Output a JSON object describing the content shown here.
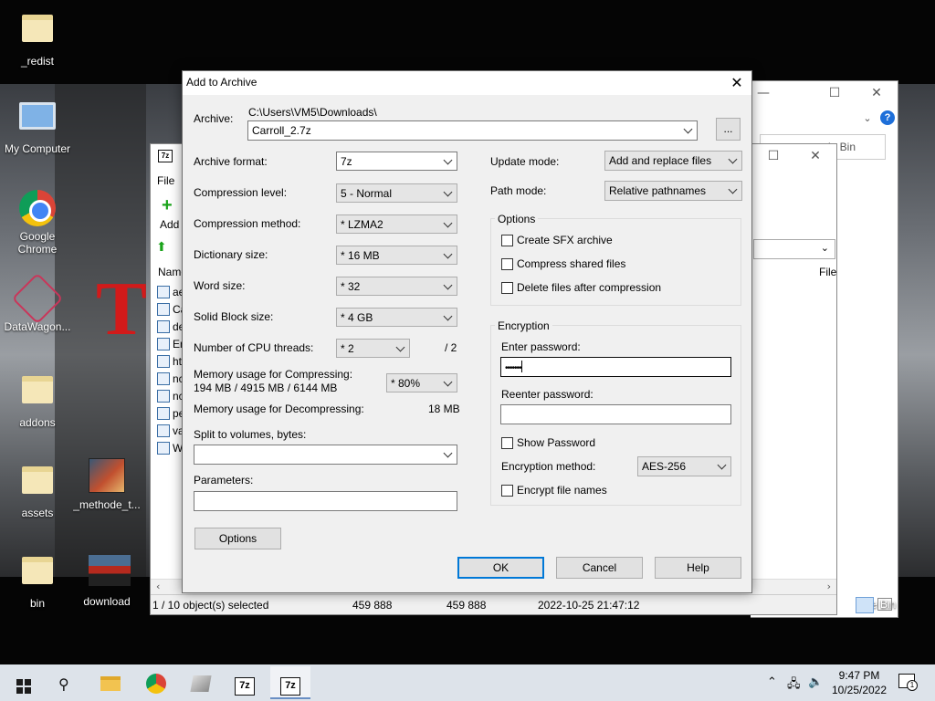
{
  "desktop": {
    "icons": [
      {
        "label": "_redist"
      },
      {
        "label": "My Computer"
      },
      {
        "label": "Google Chrome"
      },
      {
        "label": "DataWagon..."
      },
      {
        "label": "addons"
      },
      {
        "label": "assets"
      },
      {
        "label": "_methode_t..."
      },
      {
        "label": "bin"
      },
      {
        "label": "download"
      }
    ]
  },
  "sevenzip_window": {
    "menu_file": "File",
    "toolbar_add": "Add",
    "column_name": "Name",
    "column_file": "File",
    "files": [
      "ae",
      "Ca",
      "de",
      "En",
      "ht",
      "nc",
      "nc",
      "pe",
      "va",
      "W"
    ],
    "status": {
      "selected": "1 / 10 object(s) selected",
      "size": "459 888",
      "packed": "459 888",
      "modified": "2022-10-25 21:47:12"
    }
  },
  "explorer_window": {
    "search_text": "cycle Bin",
    "recycle_label": "e Bin"
  },
  "dialog": {
    "title": "Add to Archive",
    "archive_label": "Archive:",
    "archive_path": "C:\\Users\\VM5\\Downloads\\",
    "archive_name": "Carroll_2.7z",
    "browse_label": "...",
    "left": {
      "archive_format_label": "Archive format:",
      "archive_format": "7z",
      "compression_level_label": "Compression level:",
      "compression_level": "5 - Normal",
      "compression_method_label": "Compression method:",
      "compression_method": "* LZMA2",
      "dictionary_size_label": "Dictionary size:",
      "dictionary_size": "* 16 MB",
      "word_size_label": "Word size:",
      "word_size": "* 32",
      "solid_block_label": "Solid Block size:",
      "solid_block": "* 4 GB",
      "cpu_threads_label": "Number of CPU threads:",
      "cpu_threads": "* 2",
      "cpu_threads_max": "/ 2",
      "mem_compress_label": "Memory usage for Compressing:",
      "mem_compress_value": "194 MB / 4915 MB / 6144 MB",
      "mem_percent": "* 80%",
      "mem_decompress_label": "Memory usage for Decompressing:",
      "mem_decompress_value": "18 MB",
      "split_label": "Split to volumes, bytes:",
      "split_value": "",
      "parameters_label": "Parameters:",
      "parameters_value": "",
      "options_button": "Options"
    },
    "right": {
      "update_mode_label": "Update mode:",
      "update_mode": "Add and replace files",
      "path_mode_label": "Path mode:",
      "path_mode": "Relative pathnames",
      "options_group": "Options",
      "create_sfx": "Create SFX archive",
      "compress_shared": "Compress shared files",
      "delete_after": "Delete files after compression",
      "encryption_group": "Encryption",
      "enter_password_label": "Enter password:",
      "password_mask": "•••••••",
      "reenter_password_label": "Reenter password:",
      "reenter_value": "",
      "show_password": "Show Password",
      "encryption_method_label": "Encryption method:",
      "encryption_method": "AES-256",
      "encrypt_names": "Encrypt file names"
    },
    "buttons": {
      "ok": "OK",
      "cancel": "Cancel",
      "help": "Help"
    }
  },
  "taskbar": {
    "time": "9:47 PM",
    "date": "10/25/2022",
    "app_7z_label": "7z",
    "notification_count": "1"
  }
}
